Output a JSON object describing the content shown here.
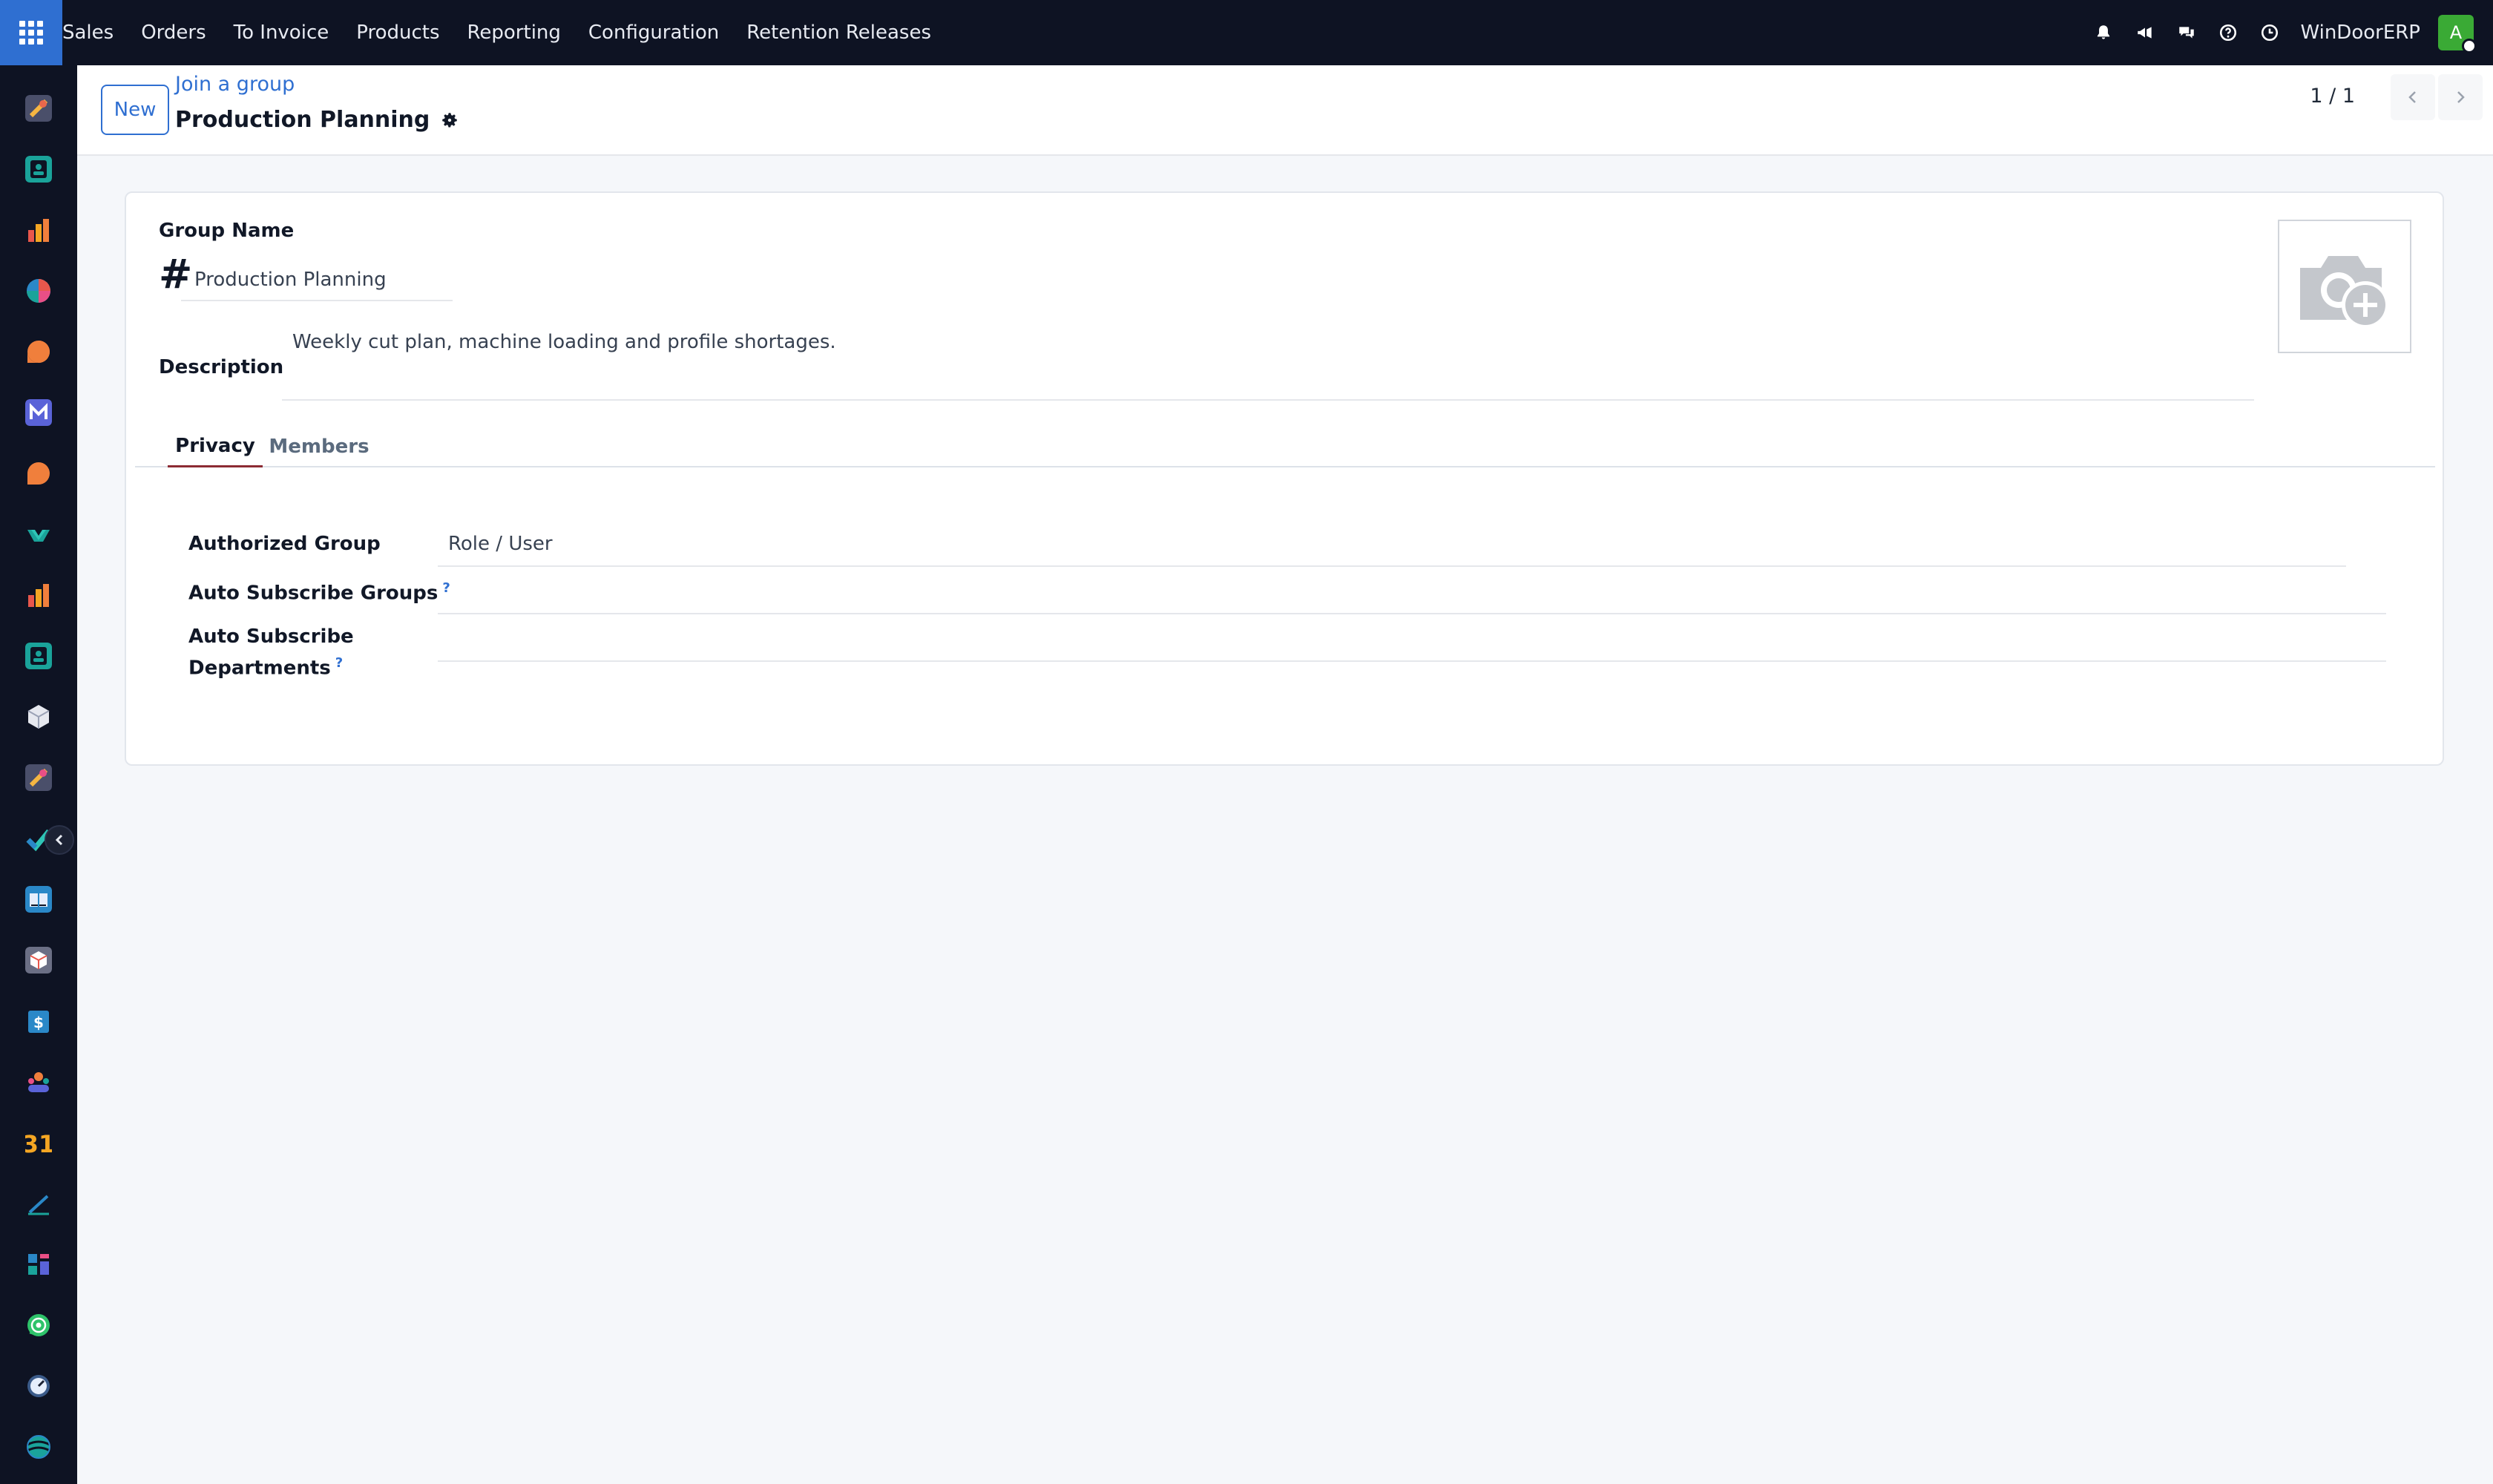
{
  "navbar": {
    "menu": [
      "Sales",
      "Orders",
      "To Invoice",
      "Products",
      "Reporting",
      "Configuration",
      "Retention Releases"
    ],
    "icons": [
      "bell-icon",
      "megaphone-icon",
      "chat-icon",
      "help-icon",
      "clock-icon"
    ],
    "company": "WinDoorERP",
    "avatar_initial": "A"
  },
  "sidebar": {
    "apps": [
      "app-icon-1",
      "app-icon-2",
      "app-icon-3",
      "app-icon-4",
      "app-icon-5",
      "app-icon-6",
      "app-icon-7",
      "app-icon-8",
      "app-icon-9",
      "app-icon-10",
      "app-icon-11",
      "app-icon-12",
      "app-icon-13",
      "app-icon-14",
      "app-icon-15",
      "app-icon-16",
      "app-icon-17",
      "calendar-31-icon",
      "app-icon-19",
      "app-icon-20",
      "whatsapp-icon",
      "app-icon-22",
      "app-icon-23"
    ],
    "calendar_text": "31"
  },
  "control": {
    "new_label": "New",
    "breadcrumb": "Join a group",
    "record_title": "Production Planning",
    "pager": "1 / 1"
  },
  "form": {
    "group_name_label": "Group Name",
    "hash": "#",
    "group_name_value": "Production Planning",
    "description_label": "Description",
    "description_value": "Weekly cut plan, machine loading and profile shortages.",
    "tabs": [
      "Privacy",
      "Members"
    ],
    "privacy": {
      "authorized_group_label": "Authorized Group",
      "authorized_group_value": "Role / User",
      "auto_groups_label": "Auto Subscribe Groups",
      "auto_departments_label_line1": "Auto Subscribe",
      "auto_departments_label_line2": "Departments",
      "help_mark": "?"
    }
  },
  "colors": {
    "navbar_bg": "#0e1323",
    "accent_blue": "#2f6fd1",
    "active_tab": "#8c2b34",
    "avatar_green": "#3aaa35"
  }
}
